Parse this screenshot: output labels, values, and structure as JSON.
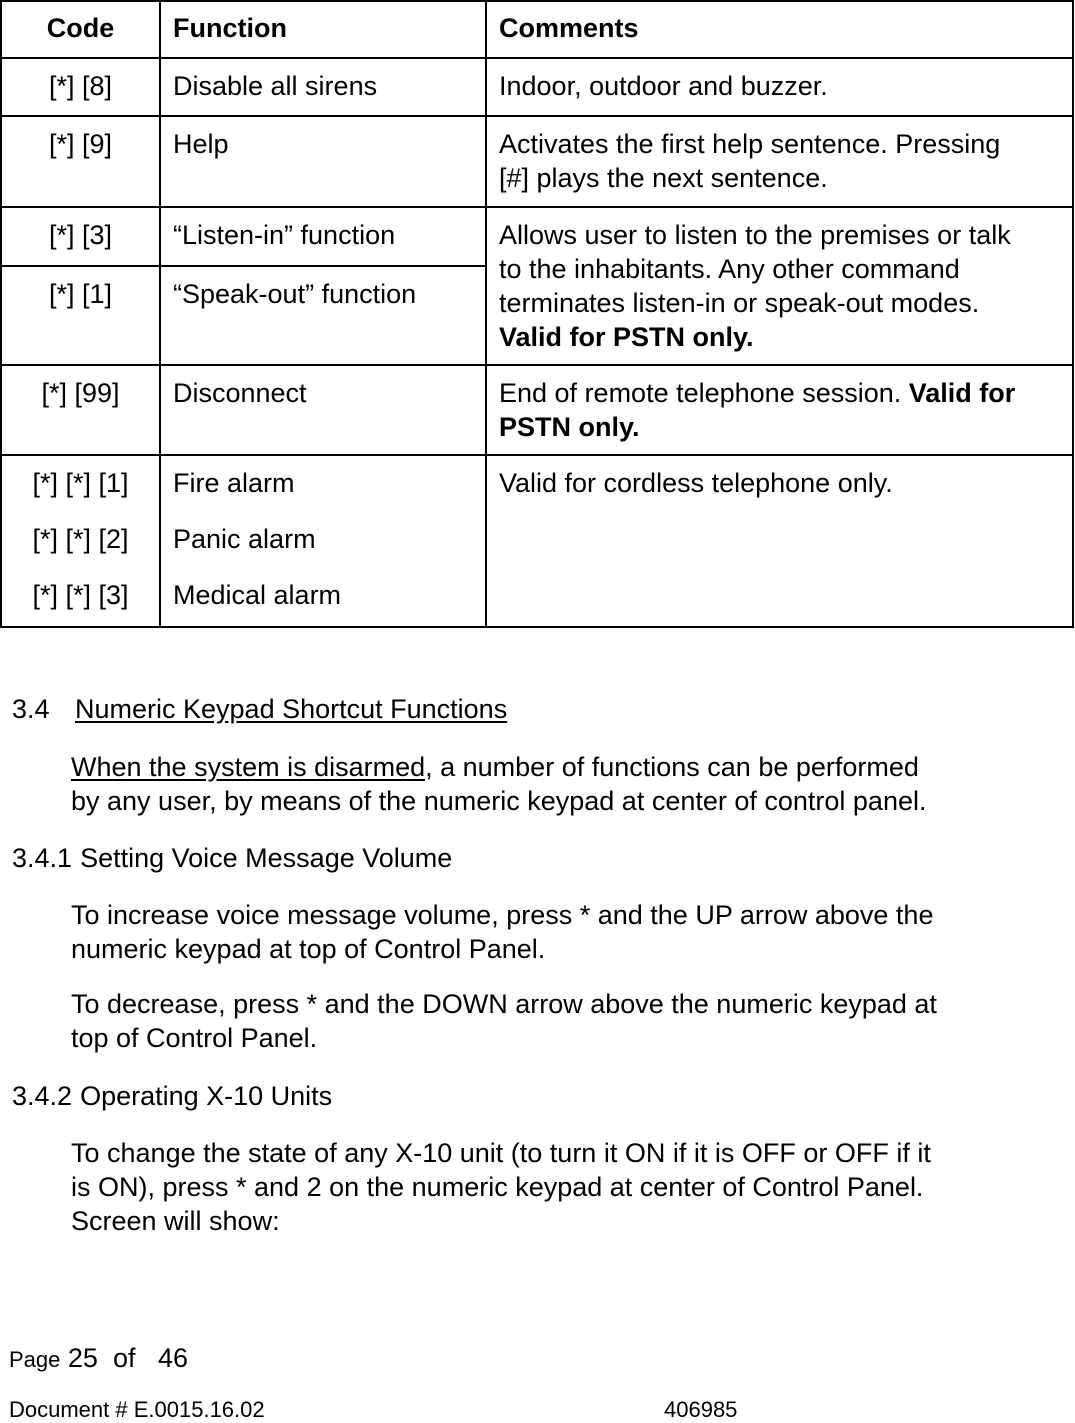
{
  "table": {
    "headers": [
      "Code",
      "Function",
      "Comments"
    ],
    "rows": [
      {
        "code": "[*] [8]",
        "function": "Disable all sirens",
        "comment": "Indoor, outdoor and buzzer."
      },
      {
        "code": "[*] [9]",
        "function": "Help",
        "comment_line1": "Activates the first help sentence. Pressing",
        "comment_line2": "[#] plays the next sentence."
      },
      {
        "code": "[*] [3]",
        "function": "“Listen-in” function"
      },
      {
        "code": "[*] [1]",
        "function": "“Speak-out” function"
      },
      {
        "code": "[*] [99]",
        "function": "Disconnect",
        "comment": "End of remote telephone session. ",
        "comment_bold": "Valid for PSTN only."
      },
      {
        "codes": [
          "[*] [*] [1]",
          "[*] [*] [2]",
          "[*] [*] [3]"
        ],
        "functions": [
          "Fire alarm",
          "Panic alarm",
          "Medical alarm"
        ],
        "comment_bold": "Valid for cordless telephone only."
      }
    ],
    "merged_comment": {
      "line1": "Allows user to listen to the premises or talk",
      "line2": "to the inhabitants. Any other command",
      "line3": "terminates listen-in or speak-out modes.",
      "bold": "Valid for PSTN only."
    }
  },
  "section_3_4": {
    "number": "3.4",
    "title": "Numeric Keypad Shortcut Functions",
    "intro_underlined": "When the system is disarmed",
    "intro_rest": ", a number of functions can be performed",
    "intro_line2": "by any user, by means of the numeric keypad at center of control panel."
  },
  "section_3_4_1": {
    "number": "3.4.1",
    "title": "Setting Voice Message Volume",
    "p1_line1": "To increase voice message volume, press * and the UP arrow above the",
    "p1_line2": "numeric keypad at top of Control Panel.",
    "p2_line1": "To decrease, press * and the DOWN arrow above the numeric keypad at",
    "p2_line2": "top of Control Panel."
  },
  "section_3_4_2": {
    "number": "3.4.2",
    "title": "Operating X-10 Units",
    "p1_line1": "To change the state of any X-10 unit (to turn it ON if it is OFF or OFF if it",
    "p1_line2": "is ON), press * and 2 on the numeric keypad at center of Control Panel.",
    "p1_line3": "Screen will show:"
  },
  "footer": {
    "page_label": "Page",
    "page_current": "25",
    "of_label": "of",
    "page_total": "46",
    "document_label": "Document # E.0015.16.02",
    "document_id": "406985"
  }
}
